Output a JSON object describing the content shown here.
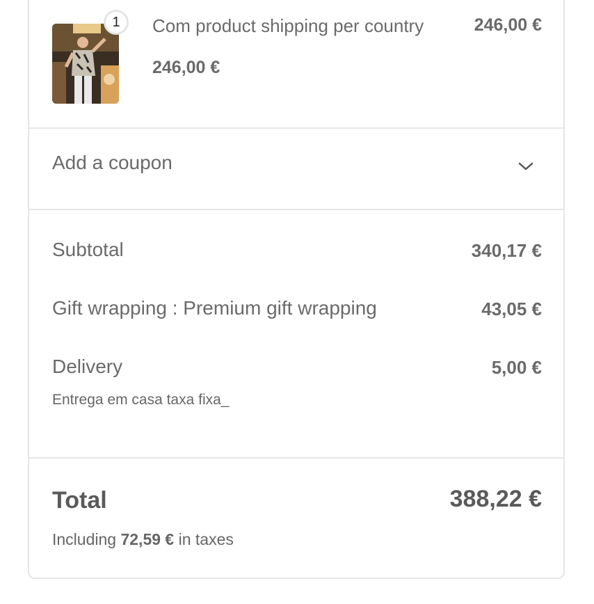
{
  "product": {
    "quantity": "1",
    "name": "Com product shipping per country",
    "price": "246,00 €",
    "unit_price": "246,00 €",
    "image_icon": "product-photo-performer"
  },
  "coupon": {
    "label": "Add a coupon",
    "icon": "chevron-down-icon"
  },
  "summary": {
    "subtotal_label": "Subtotal",
    "subtotal_value": "340,17 €",
    "gift_label": "Gift wrapping : Premium gift wrapping",
    "gift_value": "43,05 €",
    "delivery_label": "Delivery",
    "delivery_value": "5,00 €",
    "delivery_method": "Entrega em casa taxa fixa_"
  },
  "total": {
    "label": "Total",
    "value": "388,22 €",
    "tax_prefix": "Including",
    "tax_amount": "72,59 €",
    "tax_suffix": "in taxes"
  }
}
